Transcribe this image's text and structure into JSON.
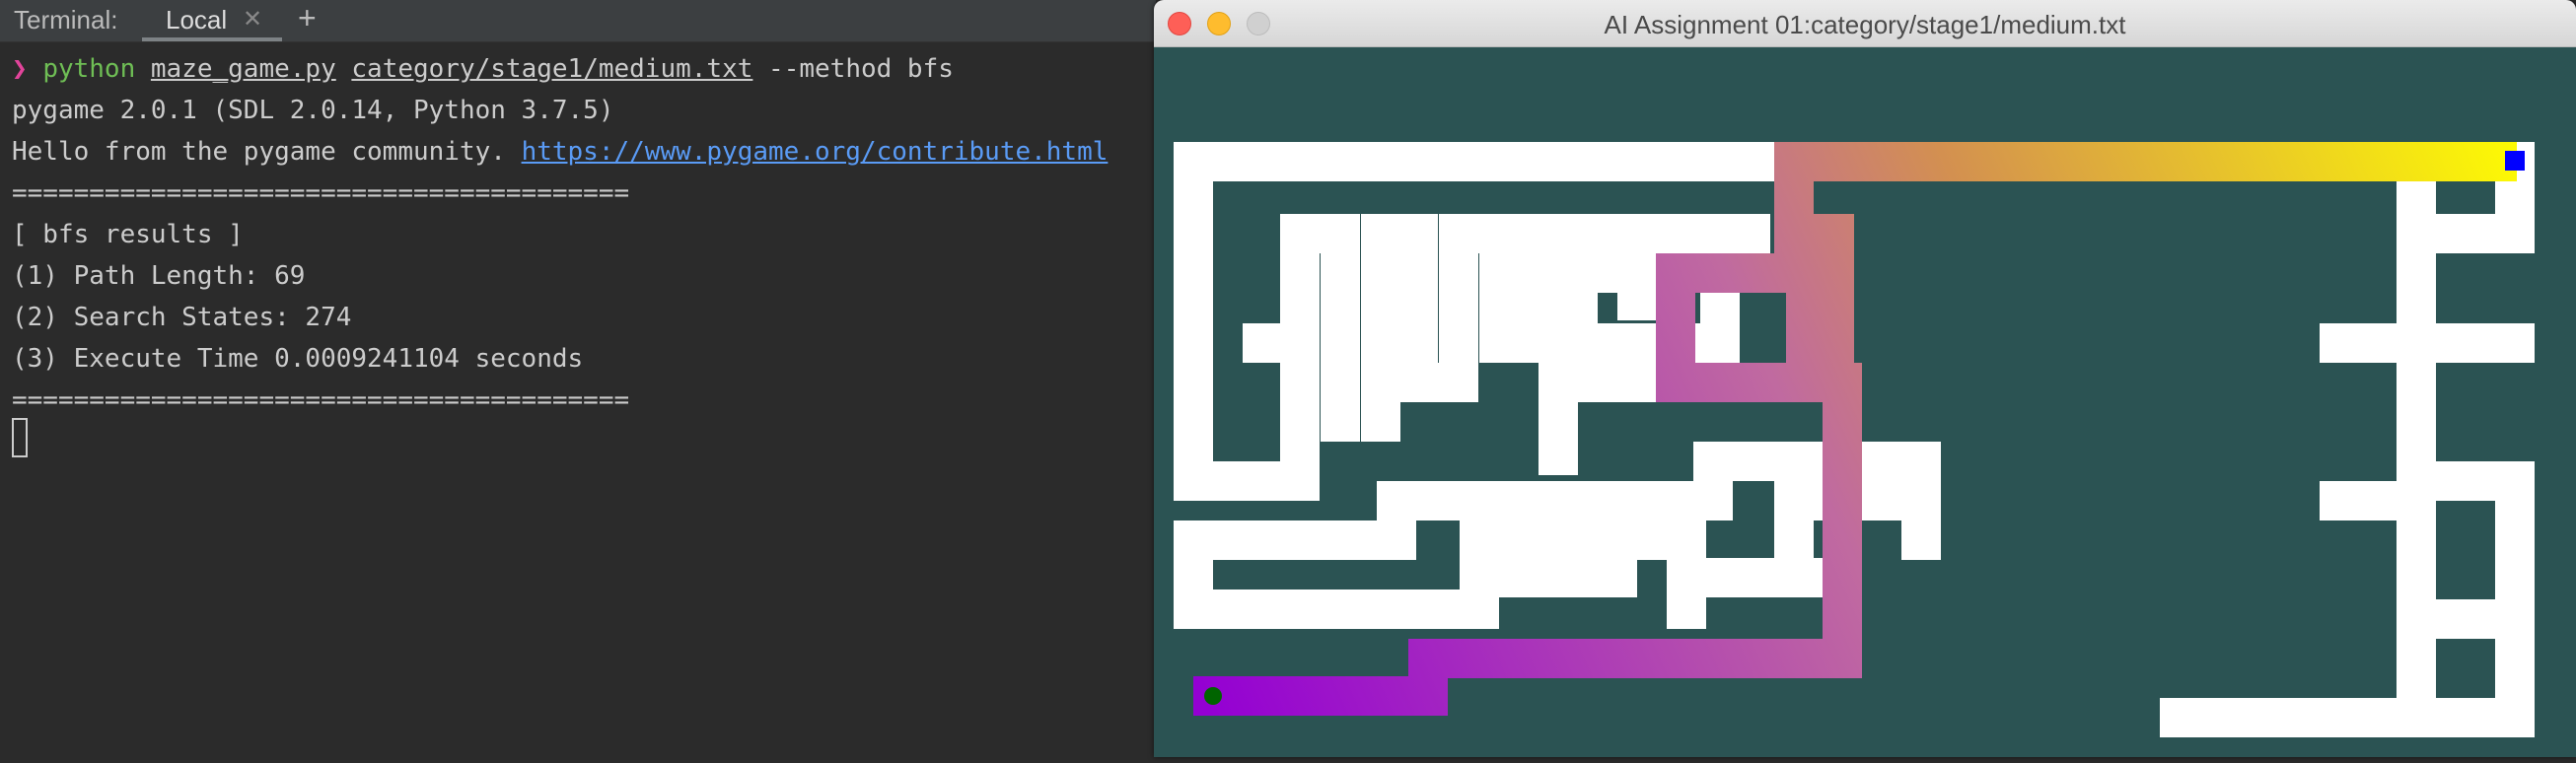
{
  "terminal": {
    "header_label": "Terminal:",
    "tab_label": "Local",
    "tab_close_icon": "close-icon",
    "add_tab_icon": "plus-icon",
    "prompt_symbol": "❯",
    "command": {
      "program": "python",
      "script": "maze_game.py",
      "maze_file": "category/stage1/medium.txt",
      "options": "--method bfs"
    },
    "output": {
      "pygame_version": "pygame 2.0.1 (SDL 2.0.14, Python 3.7.5)",
      "hello_text": "Hello from the pygame community.",
      "hello_link": "https://www.pygame.org/contribute.html",
      "separator": "========================================",
      "results_header": "[ bfs results ]",
      "path_length": "(1) Path Length: 69",
      "search_states": "(2) Search States: 274",
      "execute_time": "(3) Execute Time 0.0009241104 seconds"
    }
  },
  "game_window": {
    "title": "AI Assignment 01:category/stage1/medium.txt",
    "colors": {
      "background": "#2b5353",
      "wall": "#ffffff",
      "goal": "#0000ff",
      "start": "#006400",
      "path_start": "#9400d3",
      "path_end": "#ffff00"
    }
  }
}
